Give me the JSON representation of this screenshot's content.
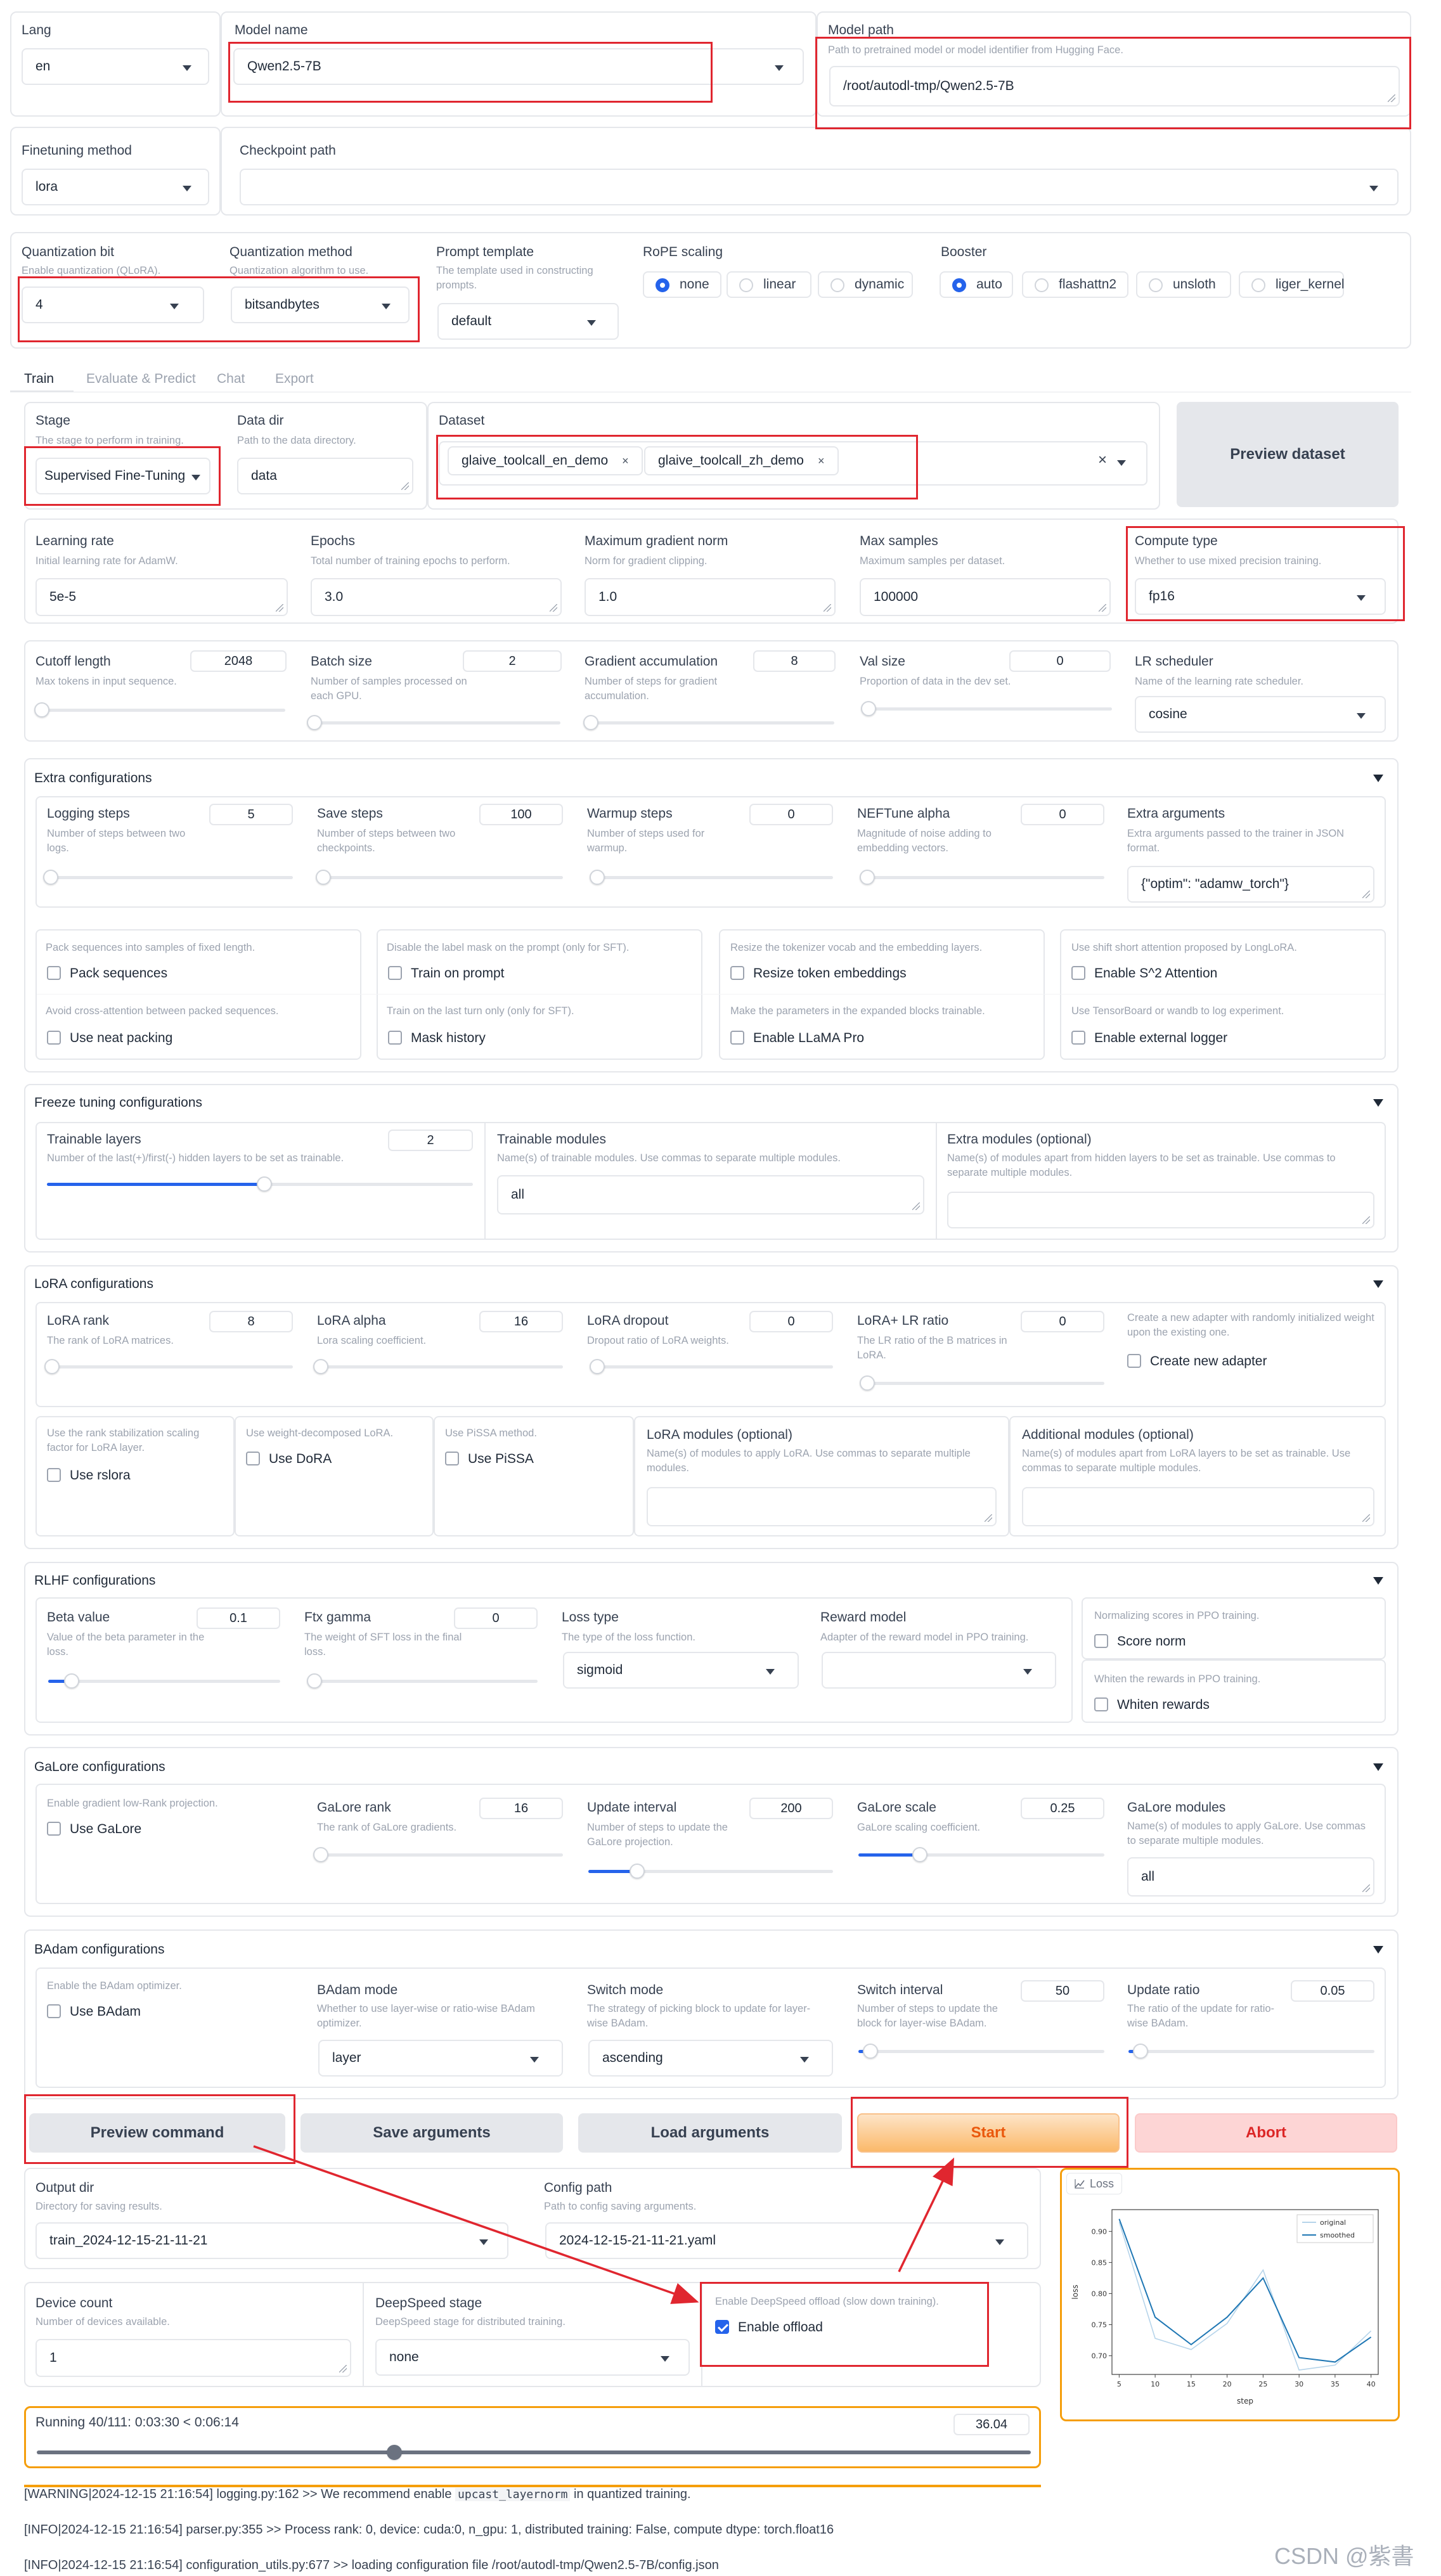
{
  "top": {
    "lang": {
      "label": "Lang",
      "value": "en"
    },
    "model_name": {
      "label": "Model name",
      "value": "Qwen2.5-7B"
    },
    "model_path": {
      "label": "Model path",
      "hint": "Path to pretrained model or model identifier from Hugging Face.",
      "value": "/root/autodl-tmp/Qwen2.5-7B"
    },
    "finetuning": {
      "label": "Finetuning method",
      "value": "lora"
    },
    "checkpoint": {
      "label": "Checkpoint path",
      "value": ""
    }
  },
  "quant": {
    "bit": {
      "label": "Quantization bit",
      "hint": "Enable quantization (QLoRA).",
      "value": "4"
    },
    "method": {
      "label": "Quantization method",
      "hint": "Quantization algorithm to use.",
      "value": "bitsandbytes"
    },
    "prompt": {
      "label": "Prompt template",
      "hint": "The template used in constructing prompts.",
      "value": "default"
    },
    "rope": {
      "label": "RoPE scaling",
      "options": [
        "none",
        "linear",
        "dynamic"
      ],
      "selected": "none"
    },
    "booster": {
      "label": "Booster",
      "options": [
        "auto",
        "flashattn2",
        "unsloth",
        "liger_kernel"
      ],
      "selected": "auto"
    }
  },
  "tabs": [
    "Train",
    "Evaluate & Predict",
    "Chat",
    "Export"
  ],
  "train": {
    "stage": {
      "label": "Stage",
      "hint": "The stage to perform in training.",
      "value": "Supervised Fine-Tuning"
    },
    "data_dir": {
      "label": "Data dir",
      "hint": "Path to the data directory.",
      "value": "data"
    },
    "dataset": {
      "label": "Dataset",
      "chips": [
        "glaive_toolcall_en_demo",
        "glaive_toolcall_zh_demo"
      ],
      "clear": "×",
      "chip_x": "×"
    },
    "preview_dataset": "Preview dataset",
    "lr": {
      "label": "Learning rate",
      "hint": "Initial learning rate for AdamW.",
      "value": "5e-5"
    },
    "epochs": {
      "label": "Epochs",
      "hint": "Total number of training epochs to perform.",
      "value": "3.0"
    },
    "grad_norm": {
      "label": "Maximum gradient norm",
      "hint": "Norm for gradient clipping.",
      "value": "1.0"
    },
    "max_samples": {
      "label": "Max samples",
      "hint": "Maximum samples per dataset.",
      "value": "100000"
    },
    "compute": {
      "label": "Compute type",
      "hint": "Whether to use mixed precision training.",
      "value": "fp16"
    },
    "cutoff": {
      "label": "Cutoff length",
      "hint": "Max tokens in input sequence.",
      "value": "2048",
      "fraction": 0.02
    },
    "batch": {
      "label": "Batch size",
      "hint": "Number of samples processed on each GPU.",
      "value": "2",
      "fraction": 0.01
    },
    "grad_acc": {
      "label": "Gradient accumulation",
      "hint": "Number of steps for gradient accumulation.",
      "value": "8",
      "fraction": 0.02
    },
    "val_size": {
      "label": "Val size",
      "hint": "Proportion of data in the dev set.",
      "value": "0",
      "fraction": 0.0
    },
    "lr_sched": {
      "label": "LR scheduler",
      "hint": "Name of the learning rate scheduler.",
      "value": "cosine"
    }
  },
  "extra": {
    "title": "Extra configurations",
    "logging": {
      "label": "Logging steps",
      "hint": "Number of steps between two logs.",
      "value": "5",
      "fraction": 0.01
    },
    "save": {
      "label": "Save steps",
      "hint": "Number of steps between two checkpoints.",
      "value": "100",
      "fraction": 0.02
    },
    "warmup": {
      "label": "Warmup steps",
      "hint": "Number of steps used for warmup.",
      "value": "0",
      "fraction": 0.0
    },
    "neftune": {
      "label": "NEFTune alpha",
      "hint": "Magnitude of noise adding to embedding vectors.",
      "value": "0",
      "fraction": 0.0
    },
    "extra_args": {
      "label": "Extra arguments",
      "hint": "Extra arguments passed to the trainer in JSON format.",
      "value": "{\"optim\": \"adamw_torch\"}"
    },
    "checks": [
      {
        "hint": "Pack sequences into samples of fixed length.",
        "label": "Pack sequences",
        "checked": false
      },
      {
        "hint": "Disable the label mask on the prompt (only for SFT).",
        "label": "Train on prompt",
        "checked": false
      },
      {
        "hint": "Resize the tokenizer vocab and the embedding layers.",
        "label": "Resize token embeddings",
        "checked": false
      },
      {
        "hint": "Use shift short attention proposed by LongLoRA.",
        "label": "Enable S^2 Attention",
        "checked": false
      },
      {
        "hint": "Avoid cross-attention between packed sequences.",
        "label": "Use neat packing",
        "checked": false
      },
      {
        "hint": "Train on the last turn only (only for SFT).",
        "label": "Mask history",
        "checked": false
      },
      {
        "hint": "Make the parameters in the expanded blocks trainable.",
        "label": "Enable LLaMA Pro",
        "checked": false
      },
      {
        "hint": "Use TensorBoard or wandb to log experiment.",
        "label": "Enable external logger",
        "checked": false
      }
    ]
  },
  "freeze": {
    "title": "Freeze tuning configurations",
    "layers": {
      "label": "Trainable layers",
      "hint": "Number of the last(+)/first(-) hidden layers to be set as trainable.",
      "value": "2",
      "fraction": 0.51
    },
    "modules": {
      "label": "Trainable modules",
      "hint": "Name(s) of trainable modules. Use commas to separate multiple modules.",
      "value": "all"
    },
    "extra_modules": {
      "label": "Extra modules (optional)",
      "hint": "Name(s) of modules apart from hidden layers to be set as trainable. Use commas to separate multiple modules.",
      "value": ""
    }
  },
  "lora": {
    "title": "LoRA configurations",
    "rank": {
      "label": "LoRA rank",
      "hint": "The rank of LoRA matrices.",
      "value": "8",
      "fraction": 0.01
    },
    "alpha": {
      "label": "LoRA alpha",
      "hint": "Lora scaling coefficient.",
      "value": "16",
      "fraction": 0.01
    },
    "dropout": {
      "label": "LoRA dropout",
      "hint": "Dropout ratio of LoRA weights.",
      "value": "0",
      "fraction": 0.0
    },
    "plus": {
      "label": "LoRA+ LR ratio",
      "hint": "The LR ratio of the B matrices in LoRA.",
      "value": "0",
      "fraction": 0.0
    },
    "new_adapter": {
      "hint": "Create a new adapter with randomly initialized weight upon the existing one.",
      "label": "Create new adapter"
    },
    "rslora": {
      "hint": "Use the rank stabilization scaling factor for LoRA layer.",
      "label": "Use rslora"
    },
    "dora": {
      "hint": "Use weight-decomposed LoRA.",
      "label": "Use DoRA"
    },
    "pissa": {
      "hint": "Use PiSSA method.",
      "label": "Use PiSSA"
    },
    "modules": {
      "label": "LoRA modules (optional)",
      "hint": "Name(s) of modules to apply LoRA. Use commas to separate multiple modules.",
      "value": ""
    },
    "additional": {
      "label": "Additional modules (optional)",
      "hint": "Name(s) of modules apart from LoRA layers to be set as trainable. Use commas to separate multiple modules.",
      "value": ""
    }
  },
  "rlhf": {
    "title": "RLHF configurations",
    "beta": {
      "label": "Beta value",
      "hint": "Value of the beta parameter in the loss.",
      "value": "0.1",
      "fraction": 0.1
    },
    "ftx": {
      "label": "Ftx gamma",
      "hint": "The weight of SFT loss in the final loss.",
      "value": "0",
      "fraction": 0.0
    },
    "loss": {
      "label": "Loss type",
      "hint": "The type of the loss function.",
      "value": "sigmoid"
    },
    "reward": {
      "label": "Reward model",
      "hint": "Adapter of the reward model in PPO training.",
      "value": ""
    },
    "score_norm": {
      "hint": "Normalizing scores in PPO training.",
      "label": "Score norm"
    },
    "whiten": {
      "hint": "Whiten the rewards in PPO training.",
      "label": "Whiten rewards"
    }
  },
  "galore": {
    "title": "GaLore configurations",
    "use": {
      "hint": "Enable gradient low-Rank projection.",
      "label": "Use GaLore"
    },
    "rank": {
      "label": "GaLore rank",
      "hint": "The rank of GaLore gradients.",
      "value": "16",
      "fraction": 0.01
    },
    "interval": {
      "label": "Update interval",
      "hint": "Number of steps to update the GaLore projection.",
      "value": "200",
      "fraction": 0.2
    },
    "scale": {
      "label": "GaLore scale",
      "hint": "GaLore scaling coefficient.",
      "value": "0.25",
      "fraction": 0.25
    },
    "modules": {
      "label": "GaLore modules",
      "hint": "Name(s) of modules to apply GaLore. Use commas to separate multiple modules.",
      "value": "all"
    }
  },
  "badam": {
    "title": "BAdam configurations",
    "use": {
      "hint": "Enable the BAdam optimizer.",
      "label": "Use BAdam"
    },
    "mode": {
      "label": "BAdam mode",
      "hint": "Whether to use layer-wise or ratio-wise BAdam optimizer.",
      "value": "layer"
    },
    "switch_mode": {
      "label": "Switch mode",
      "hint": "The strategy of picking block to update for layer-wise BAdam.",
      "value": "ascending"
    },
    "interval": {
      "label": "Switch interval",
      "hint": "Number of steps to update the block for layer-wise BAdam.",
      "value": "50",
      "fraction": 0.05
    },
    "ratio": {
      "label": "Update ratio",
      "hint": "The ratio of the update for ratio-wise BAdam.",
      "value": "0.05",
      "fraction": 0.05
    }
  },
  "actions": {
    "preview": "Preview command",
    "save": "Save arguments",
    "load": "Load arguments",
    "start": "Start",
    "abort": "Abort"
  },
  "output": {
    "dir": {
      "label": "Output dir",
      "hint": "Directory for saving results.",
      "value": "train_2024-12-15-21-11-21"
    },
    "config": {
      "label": "Config path",
      "hint": "Path to config saving arguments.",
      "value": "2024-12-15-21-11-21.yaml"
    },
    "devices": {
      "label": "Device count",
      "hint": "Number of devices available.",
      "value": "1"
    },
    "deepspeed": {
      "label": "DeepSpeed stage",
      "hint": "DeepSpeed stage for distributed training.",
      "value": "none"
    },
    "offload": {
      "hint": "Enable DeepSpeed offload (slow down training).",
      "label": "Enable offload",
      "checked": true
    }
  },
  "progress": {
    "text": "Running 40/111: 0:03:30 < 0:06:14",
    "value": "36.04",
    "fraction": 0.36
  },
  "logs": [
    "[WARNING|2024-12-15 21:16:54] logging.py:162 >> We recommend enable ",
    "upcast_layernorm",
    " in quantized training.",
    "[INFO|2024-12-15 21:16:54] parser.py:355 >> Process rank: 0, device: cuda:0, n_gpu: 1, distributed training: False, compute dtype: torch.float16",
    "[INFO|2024-12-15 21:16:54] configuration_utils.py:677 >> loading configuration file /root/autodl-tmp/Qwen2.5-7B/config.json"
  ],
  "watermark": "CSDN @紫書",
  "chart_data": {
    "type": "line",
    "title": "Loss",
    "xlabel": "step",
    "ylabel": "loss",
    "xlim": [
      4,
      41
    ],
    "ylim": [
      0.67,
      0.935
    ],
    "xticks": [
      5,
      10,
      15,
      20,
      25,
      30,
      35,
      40
    ],
    "yticks": [
      0.7,
      0.75,
      0.8,
      0.85,
      0.9
    ],
    "legend_position": "top-right",
    "series": [
      {
        "name": "original",
        "color": "#b6d4ea",
        "x": [
          5,
          10,
          15,
          20,
          25,
          30,
          35,
          40
        ],
        "y": [
          0.915,
          0.728,
          0.71,
          0.752,
          0.838,
          0.677,
          0.685,
          0.74
        ]
      },
      {
        "name": "smoothed",
        "color": "#1f77b4",
        "x": [
          5,
          10,
          15,
          20,
          25,
          30,
          35,
          40
        ],
        "y": [
          0.92,
          0.762,
          0.718,
          0.762,
          0.825,
          0.697,
          0.69,
          0.73
        ]
      }
    ]
  }
}
